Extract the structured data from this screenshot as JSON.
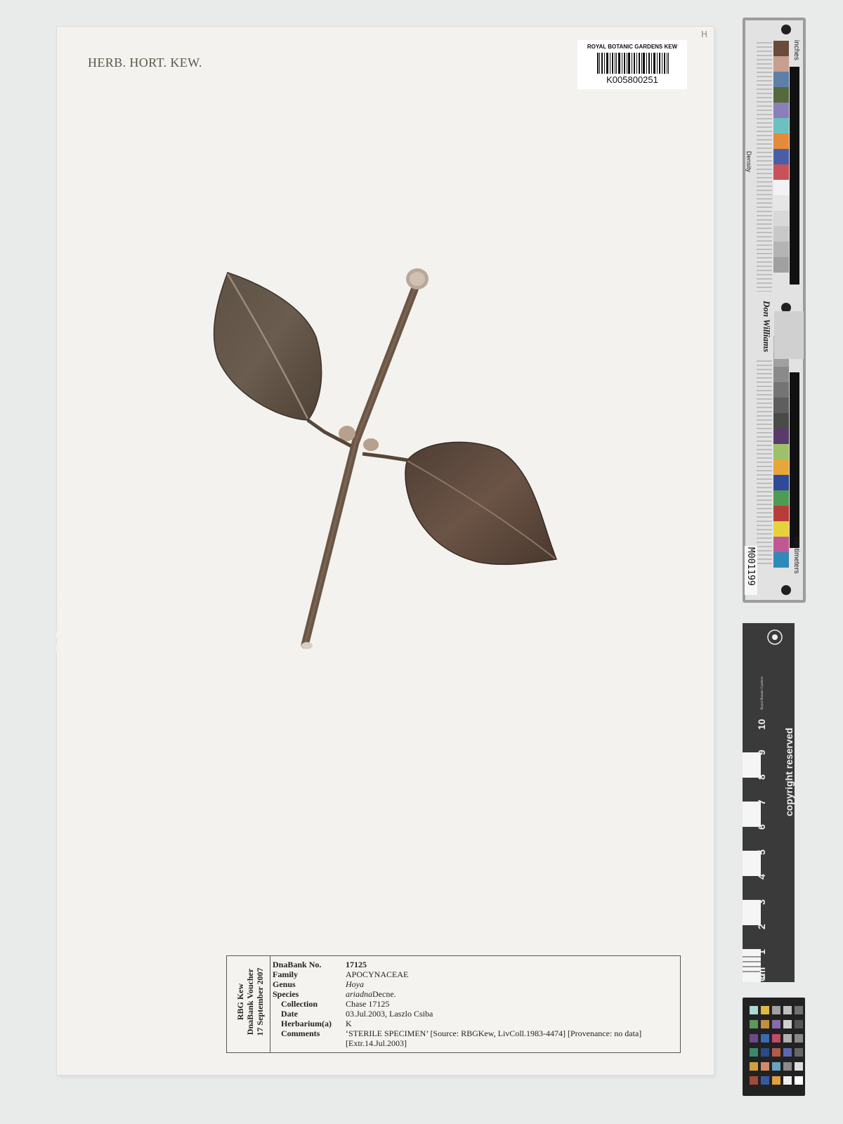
{
  "sheet": {
    "header": "HERB. HORT. KEW.",
    "pencil_mark": "H"
  },
  "barcode": {
    "institution": "ROYAL BOTANIC GARDENS KEW",
    "number": "K005800251"
  },
  "colour_ruler": {
    "top_label": "inches",
    "bottom_label": "centimeters",
    "density_label": "Density",
    "brand": "Don Williams",
    "code": "M001199",
    "patch_colors": [
      "#6a4a3c",
      "#c89e8e",
      "#5d7fa8",
      "#55693e",
      "#8880b6",
      "#6cc0c0",
      "#e48a3a",
      "#4a5ea8",
      "#c8525a",
      "#5a3a6a",
      "#9ec06a",
      "#e6a63a",
      "#2e4a98",
      "#4f9a55",
      "#b83c3a",
      "#e6d23a",
      "#c05896",
      "#2f8ab8"
    ]
  },
  "kew_scale": {
    "logo": "Kew",
    "logo_subtitle": "Royal Botanic Gardens",
    "copyright": "copyright reserved",
    "unit": "cm",
    "numbers": [
      "0",
      "1",
      "2",
      "3",
      "4",
      "5",
      "6",
      "7",
      "8",
      "9",
      "10"
    ]
  },
  "label": {
    "voucher_lines": [
      "RBG Kew",
      "DnaBank Voucher",
      "17 September 2007"
    ],
    "fields": [
      {
        "key": "DnaBank No.",
        "value": "17125"
      },
      {
        "key": "Family",
        "value": "APOCYNACEAE"
      },
      {
        "key": "Genus",
        "value": "Hoya"
      },
      {
        "key": "Species",
        "value": "ariadna",
        "value_suffix": " Decne."
      },
      {
        "key": "Collection",
        "value": "Chase 17125"
      },
      {
        "key": "Date",
        "value": "03.Jul.2003, Laszlo Csiba"
      },
      {
        "key": "Herbarium(a)",
        "value": "K"
      },
      {
        "key": "Comments",
        "value": "‘STERILE SPECIMEN’ [Source: RBGKew, LivColl.1983-4474] [Provenance: no data]",
        "value_line2": "[Extr.14.Jul.2003]"
      }
    ]
  },
  "colors": {
    "sheet": "#f3f2ee",
    "leaf": "#5b4a3a",
    "stem": "#6b5646"
  }
}
